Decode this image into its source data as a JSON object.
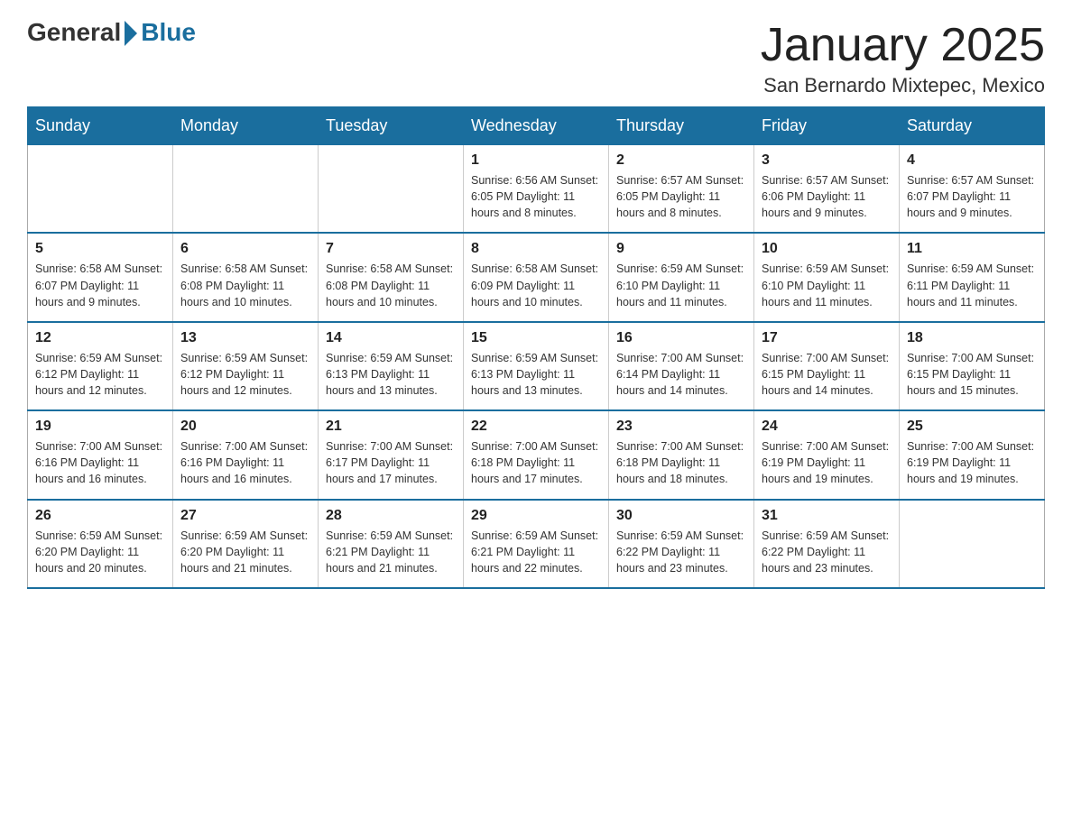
{
  "logo": {
    "general": "General",
    "blue": "Blue"
  },
  "title": "January 2025",
  "subtitle": "San Bernardo Mixtepec, Mexico",
  "weekdays": [
    "Sunday",
    "Monday",
    "Tuesday",
    "Wednesday",
    "Thursday",
    "Friday",
    "Saturday"
  ],
  "weeks": [
    [
      {
        "day": "",
        "info": ""
      },
      {
        "day": "",
        "info": ""
      },
      {
        "day": "",
        "info": ""
      },
      {
        "day": "1",
        "info": "Sunrise: 6:56 AM\nSunset: 6:05 PM\nDaylight: 11 hours and 8 minutes."
      },
      {
        "day": "2",
        "info": "Sunrise: 6:57 AM\nSunset: 6:05 PM\nDaylight: 11 hours and 8 minutes."
      },
      {
        "day": "3",
        "info": "Sunrise: 6:57 AM\nSunset: 6:06 PM\nDaylight: 11 hours and 9 minutes."
      },
      {
        "day": "4",
        "info": "Sunrise: 6:57 AM\nSunset: 6:07 PM\nDaylight: 11 hours and 9 minutes."
      }
    ],
    [
      {
        "day": "5",
        "info": "Sunrise: 6:58 AM\nSunset: 6:07 PM\nDaylight: 11 hours and 9 minutes."
      },
      {
        "day": "6",
        "info": "Sunrise: 6:58 AM\nSunset: 6:08 PM\nDaylight: 11 hours and 10 minutes."
      },
      {
        "day": "7",
        "info": "Sunrise: 6:58 AM\nSunset: 6:08 PM\nDaylight: 11 hours and 10 minutes."
      },
      {
        "day": "8",
        "info": "Sunrise: 6:58 AM\nSunset: 6:09 PM\nDaylight: 11 hours and 10 minutes."
      },
      {
        "day": "9",
        "info": "Sunrise: 6:59 AM\nSunset: 6:10 PM\nDaylight: 11 hours and 11 minutes."
      },
      {
        "day": "10",
        "info": "Sunrise: 6:59 AM\nSunset: 6:10 PM\nDaylight: 11 hours and 11 minutes."
      },
      {
        "day": "11",
        "info": "Sunrise: 6:59 AM\nSunset: 6:11 PM\nDaylight: 11 hours and 11 minutes."
      }
    ],
    [
      {
        "day": "12",
        "info": "Sunrise: 6:59 AM\nSunset: 6:12 PM\nDaylight: 11 hours and 12 minutes."
      },
      {
        "day": "13",
        "info": "Sunrise: 6:59 AM\nSunset: 6:12 PM\nDaylight: 11 hours and 12 minutes."
      },
      {
        "day": "14",
        "info": "Sunrise: 6:59 AM\nSunset: 6:13 PM\nDaylight: 11 hours and 13 minutes."
      },
      {
        "day": "15",
        "info": "Sunrise: 6:59 AM\nSunset: 6:13 PM\nDaylight: 11 hours and 13 minutes."
      },
      {
        "day": "16",
        "info": "Sunrise: 7:00 AM\nSunset: 6:14 PM\nDaylight: 11 hours and 14 minutes."
      },
      {
        "day": "17",
        "info": "Sunrise: 7:00 AM\nSunset: 6:15 PM\nDaylight: 11 hours and 14 minutes."
      },
      {
        "day": "18",
        "info": "Sunrise: 7:00 AM\nSunset: 6:15 PM\nDaylight: 11 hours and 15 minutes."
      }
    ],
    [
      {
        "day": "19",
        "info": "Sunrise: 7:00 AM\nSunset: 6:16 PM\nDaylight: 11 hours and 16 minutes."
      },
      {
        "day": "20",
        "info": "Sunrise: 7:00 AM\nSunset: 6:16 PM\nDaylight: 11 hours and 16 minutes."
      },
      {
        "day": "21",
        "info": "Sunrise: 7:00 AM\nSunset: 6:17 PM\nDaylight: 11 hours and 17 minutes."
      },
      {
        "day": "22",
        "info": "Sunrise: 7:00 AM\nSunset: 6:18 PM\nDaylight: 11 hours and 17 minutes."
      },
      {
        "day": "23",
        "info": "Sunrise: 7:00 AM\nSunset: 6:18 PM\nDaylight: 11 hours and 18 minutes."
      },
      {
        "day": "24",
        "info": "Sunrise: 7:00 AM\nSunset: 6:19 PM\nDaylight: 11 hours and 19 minutes."
      },
      {
        "day": "25",
        "info": "Sunrise: 7:00 AM\nSunset: 6:19 PM\nDaylight: 11 hours and 19 minutes."
      }
    ],
    [
      {
        "day": "26",
        "info": "Sunrise: 6:59 AM\nSunset: 6:20 PM\nDaylight: 11 hours and 20 minutes."
      },
      {
        "day": "27",
        "info": "Sunrise: 6:59 AM\nSunset: 6:20 PM\nDaylight: 11 hours and 21 minutes."
      },
      {
        "day": "28",
        "info": "Sunrise: 6:59 AM\nSunset: 6:21 PM\nDaylight: 11 hours and 21 minutes."
      },
      {
        "day": "29",
        "info": "Sunrise: 6:59 AM\nSunset: 6:21 PM\nDaylight: 11 hours and 22 minutes."
      },
      {
        "day": "30",
        "info": "Sunrise: 6:59 AM\nSunset: 6:22 PM\nDaylight: 11 hours and 23 minutes."
      },
      {
        "day": "31",
        "info": "Sunrise: 6:59 AM\nSunset: 6:22 PM\nDaylight: 11 hours and 23 minutes."
      },
      {
        "day": "",
        "info": ""
      }
    ]
  ]
}
